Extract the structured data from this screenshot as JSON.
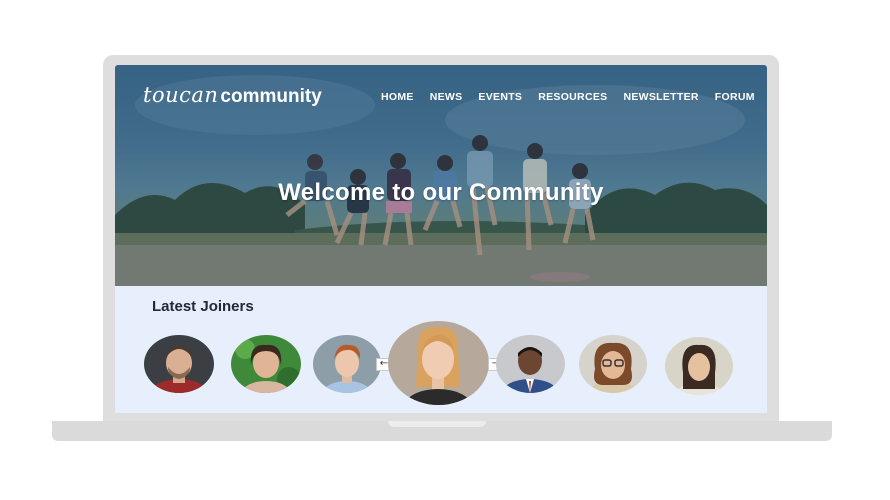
{
  "site": {
    "brand_script": "toucan",
    "brand_bold": "community"
  },
  "nav": {
    "items": [
      "HOME",
      "NEWS",
      "EVENTS",
      "RESOURCES",
      "NEWSLETTER",
      "FORUM"
    ]
  },
  "hero": {
    "title": "Welcome to our Community"
  },
  "joiners": {
    "title": "Latest Joiners",
    "prev_icon": "arrow-left-icon",
    "next_icon": "arrow-right-icon",
    "prev_glyph": "←",
    "next_glyph": "→"
  },
  "colors": {
    "page_background": "#ffffff",
    "laptop_frame": "#dedede",
    "section_background": "#e6effb",
    "heading_text": "#222a33",
    "hero_text": "#ffffff"
  }
}
